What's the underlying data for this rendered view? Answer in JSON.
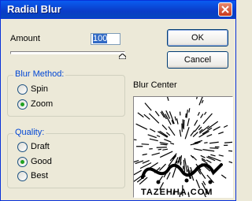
{
  "dialog": {
    "title": "Radial Blur"
  },
  "amount": {
    "label": "Amount",
    "value": "100"
  },
  "blur_method": {
    "title": "Blur Method:",
    "options": [
      "Spin",
      "Zoom"
    ],
    "selected": "Zoom"
  },
  "quality": {
    "title": "Quality:",
    "options": [
      "Draft",
      "Good",
      "Best"
    ],
    "selected": "Good"
  },
  "buttons": {
    "ok": "OK",
    "cancel": "Cancel"
  },
  "preview": {
    "label": "Blur Center"
  },
  "watermark": {
    "text": "TAZEHHA.COM"
  },
  "icons": {
    "close": "close-icon"
  }
}
